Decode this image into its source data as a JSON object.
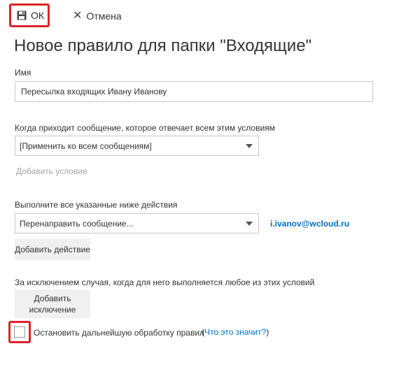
{
  "toolbar": {
    "ok_label": "ОК",
    "cancel_label": "Отмена"
  },
  "title": "Новое правило для папки \"Входящие\"",
  "name_section": {
    "label": "Имя",
    "value": "Пересылка входящих Ивану Иванову"
  },
  "condition_section": {
    "label": "Когда приходит сообщение, которое отвечает всем этим условиям",
    "selected": "[Применить ко всем сообщениям]",
    "add_condition_label": "Добавить условие"
  },
  "action_section": {
    "label": "Выполните все указанные ниже действия",
    "selected": "Перенаправить сообщение...",
    "recipient": "i.ivanov@wcloud.ru",
    "add_action_label": "Добавить действие"
  },
  "exception_section": {
    "label": "За исключением случая, когда для него выполняется любое из этих условий",
    "add_exception_label_line1": "Добавить",
    "add_exception_label_line2": "исключение"
  },
  "stop_processing": {
    "label": "Остановить дальнейшую обработку правил",
    "help_open": "(",
    "help_link": "Что это значит?",
    "help_close": ")",
    "checked": false
  },
  "colors": {
    "highlight": "#d9252b",
    "link": "#0072c6",
    "disabled_text": "#a6a6a6",
    "button_bg": "#f0f0f0"
  },
  "icons": {
    "ok": "save-icon",
    "cancel": "close-icon",
    "dropdown": "caret-down-icon"
  }
}
